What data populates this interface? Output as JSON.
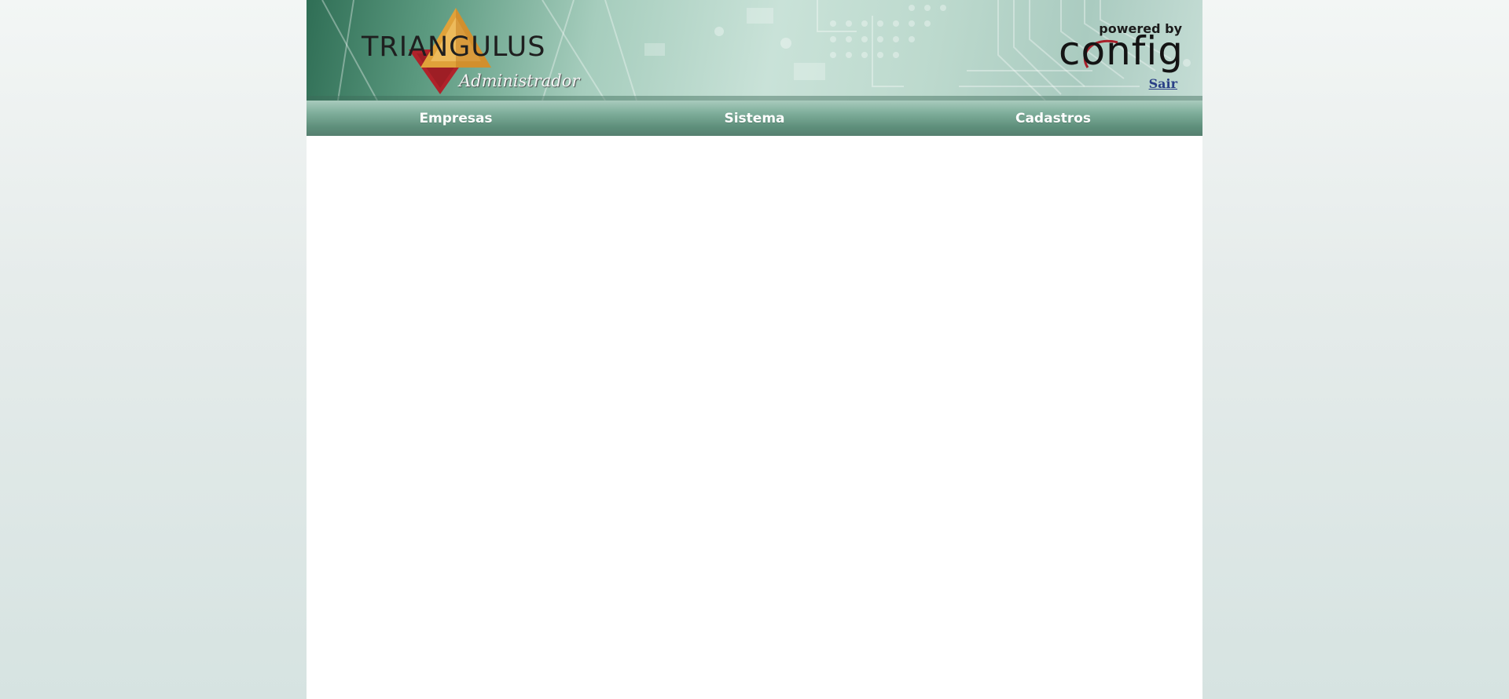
{
  "header": {
    "logo_name": "TRIANGULUS",
    "logo_subtitle": "Administrador",
    "powered_label": "powered by",
    "brand": "config",
    "logout_label": "Sair"
  },
  "nav": {
    "items": [
      {
        "label": "Empresas"
      },
      {
        "label": "Sistema"
      },
      {
        "label": "Cadastros"
      }
    ]
  },
  "colors": {
    "nav_green": "#6a9a86",
    "logout_link": "#2a3f86",
    "triangle_red": "#b0222a",
    "triangle_gold": "#e0a23a"
  }
}
